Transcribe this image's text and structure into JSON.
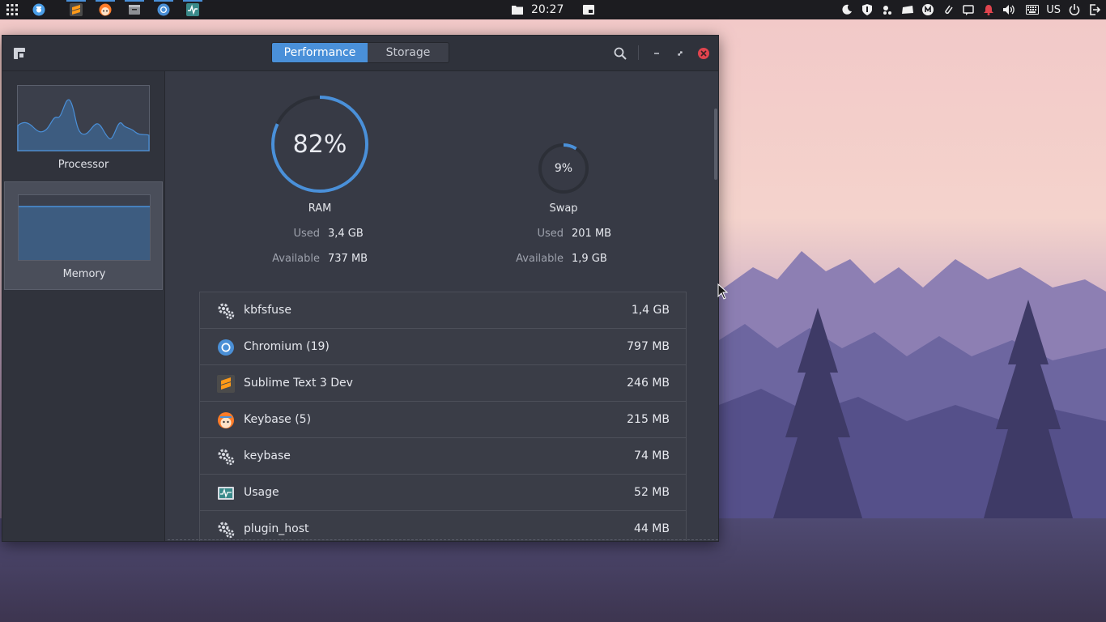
{
  "panel": {
    "clock": "20:27",
    "keyboard_layout": "US",
    "launchers": [
      {
        "icon": "grid-apps-icon",
        "active": false
      },
      {
        "icon": "screenshot-icon",
        "active": true
      },
      {
        "icon": "sublime-icon",
        "active": true
      },
      {
        "icon": "keybase-icon",
        "active": true
      },
      {
        "icon": "files-icon",
        "active": true
      },
      {
        "icon": "chromium-icon",
        "active": true
      },
      {
        "icon": "usage-icon",
        "active": true
      }
    ]
  },
  "window": {
    "tabs": [
      {
        "label": "Performance",
        "active": true
      },
      {
        "label": "Storage",
        "active": false
      }
    ],
    "sidebar": {
      "items": [
        {
          "label": "Processor",
          "selected": false
        },
        {
          "label": "Memory",
          "selected": true
        }
      ]
    },
    "ram": {
      "percent_label": "82%",
      "percent": 82,
      "title": "RAM",
      "used_key": "Used",
      "used_val": "3,4 GB",
      "avail_key": "Available",
      "avail_val": "737 MB"
    },
    "swap": {
      "percent_label": "9%",
      "percent": 9,
      "title": "Swap",
      "used_key": "Used",
      "used_val": "201 MB",
      "avail_key": "Available",
      "avail_val": "1,9 GB"
    },
    "processes": [
      {
        "name": "kbfsfuse",
        "mem": "1,4 GB",
        "icon": "gears-icon"
      },
      {
        "name": "Chromium (19)",
        "mem": "797 MB",
        "icon": "chromium-icon"
      },
      {
        "name": "Sublime Text 3 Dev",
        "mem": "246 MB",
        "icon": "sublime-icon"
      },
      {
        "name": "Keybase (5)",
        "mem": "215 MB",
        "icon": "keybase-icon"
      },
      {
        "name": "keybase",
        "mem": "74 MB",
        "icon": "gears-icon"
      },
      {
        "name": "Usage",
        "mem": "52 MB",
        "icon": "usage-icon"
      },
      {
        "name": "plugin_host",
        "mem": "44 MB",
        "icon": "gears-icon"
      }
    ]
  },
  "colors": {
    "accent": "#4a90d9",
    "close": "#e0444e"
  }
}
